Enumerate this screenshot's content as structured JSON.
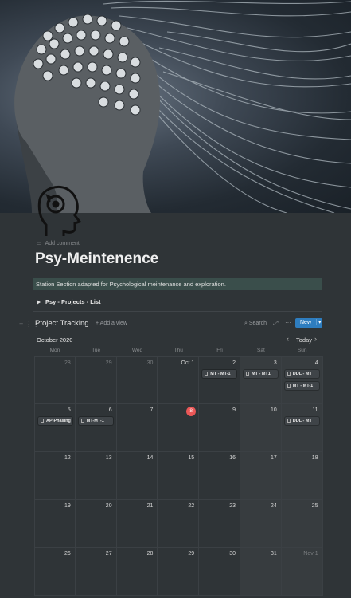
{
  "page": {
    "add_comment": "Add comment",
    "title": "Psy-Meintenence",
    "callout": "Station Section adapted for Psychological meintenance and exploration.",
    "toggle": "Psy - Projects - List"
  },
  "database": {
    "title": "Ptoject Tracking",
    "add_view": "+ Add a view",
    "search": "Search",
    "new_button": "New",
    "new_caret": "▾"
  },
  "calendar": {
    "month": "October 2020",
    "today_button": "Today",
    "weekdays": [
      "Mon",
      "Tue",
      "Wed",
      "Thu",
      "Fri",
      "Sat",
      "Sun"
    ],
    "days": [
      [
        "28",
        "29",
        "30",
        "Oct 1",
        "2",
        "3",
        "4"
      ],
      [
        "5",
        "6",
        "7",
        "8",
        "9",
        "10",
        "11"
      ],
      [
        "12",
        "13",
        "14",
        "15",
        "16",
        "17",
        "18"
      ],
      [
        "19",
        "20",
        "21",
        "22",
        "23",
        "24",
        "25"
      ],
      [
        "26",
        "27",
        "28",
        "29",
        "30",
        "31",
        "Nov 1"
      ]
    ],
    "today_label": "8",
    "events": {
      "oct2": "MT - MT-1",
      "oct3": "MT - MT1",
      "oct4_a": "DDL - MT",
      "oct4_b": "MT - MT-1",
      "oct5": "AP-Phasing",
      "oct6": "MT-MT-1",
      "oct11": "DDL - MT"
    }
  },
  "colors": {
    "accent": "#2e7dbf",
    "today": "#eb5757",
    "callout_bg": "#3a4e4b",
    "background": "#2f3437"
  }
}
